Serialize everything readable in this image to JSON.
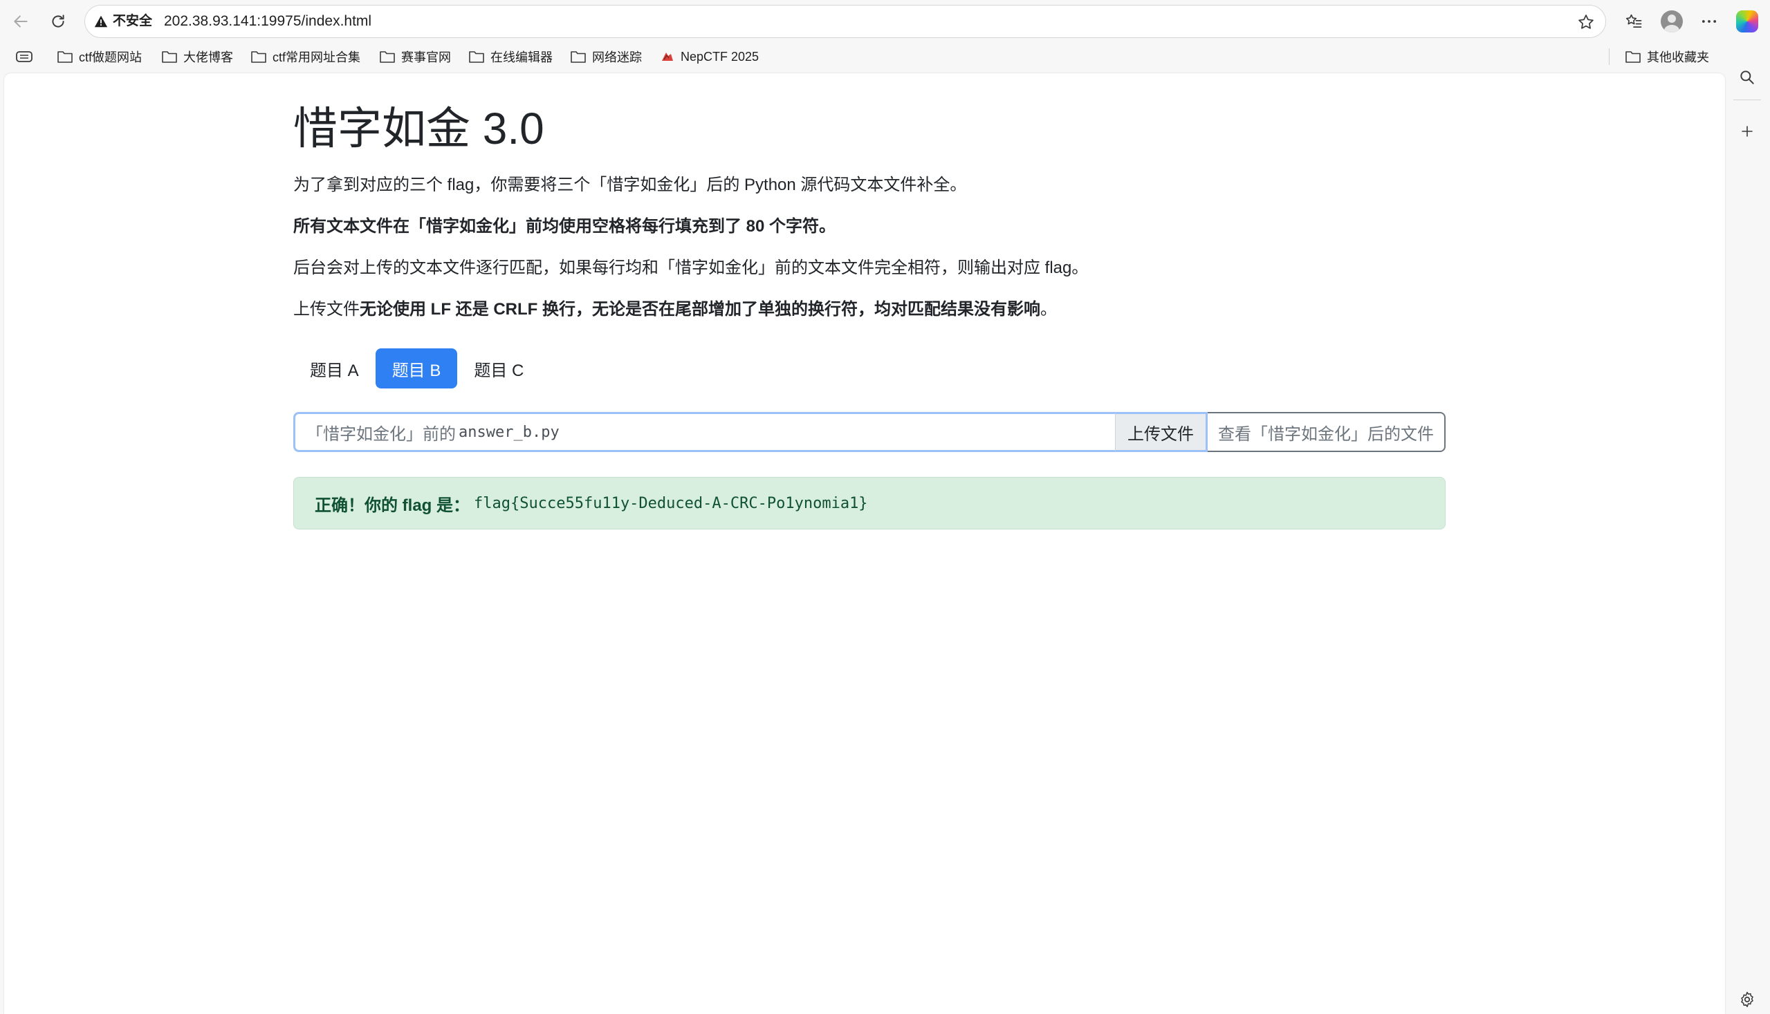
{
  "browser": {
    "security_label": "不安全",
    "url": "202.38.93.141:19975/index.html",
    "bookmarks": [
      {
        "label": "ctf做题网站"
      },
      {
        "label": "大佬博客"
      },
      {
        "label": "ctf常用网址合集"
      },
      {
        "label": "赛事官网"
      },
      {
        "label": "在线编辑器"
      },
      {
        "label": "网络迷踪"
      },
      {
        "label": "NepCTF 2025"
      }
    ],
    "other_bookmarks": "其他收藏夹"
  },
  "page": {
    "title": "惜字如金 3.0",
    "p1": "为了拿到对应的三个 flag，你需要将三个「惜字如金化」后的 Python 源代码文本文件补全。",
    "p2": "所有文本文件在「惜字如金化」前均使用空格将每行填充到了 80 个字符。",
    "p3": "后台会对上传的文本文件逐行匹配，如果每行均和「惜字如金化」前的文本文件完全相符，则输出对应 flag。",
    "p4_prefix": "上传文件",
    "p4_bold": "无论使用 LF 还是 CRLF 换行，无论是否在尾部增加了单独的换行符，均对匹配结果没有影响",
    "p4_suffix": "。",
    "tabs": [
      {
        "label": "题目 A",
        "active": false
      },
      {
        "label": "题目 B",
        "active": true
      },
      {
        "label": "题目 C",
        "active": false
      }
    ],
    "file_placeholder_cn": "「惜字如金化」前的",
    "file_placeholder_name": "answer_b.py",
    "upload_label": "上传文件",
    "view_label": "查看「惜字如金化」后的文件",
    "alert_label": "正确！你的 flag 是：",
    "flag": "flag{Succe55fu11y-Deduced-A-CRC-Po1ynomia1}"
  },
  "colors": {
    "accent": "#2f80f2",
    "success_bg": "#d8eede",
    "success_text": "#0f5132"
  }
}
